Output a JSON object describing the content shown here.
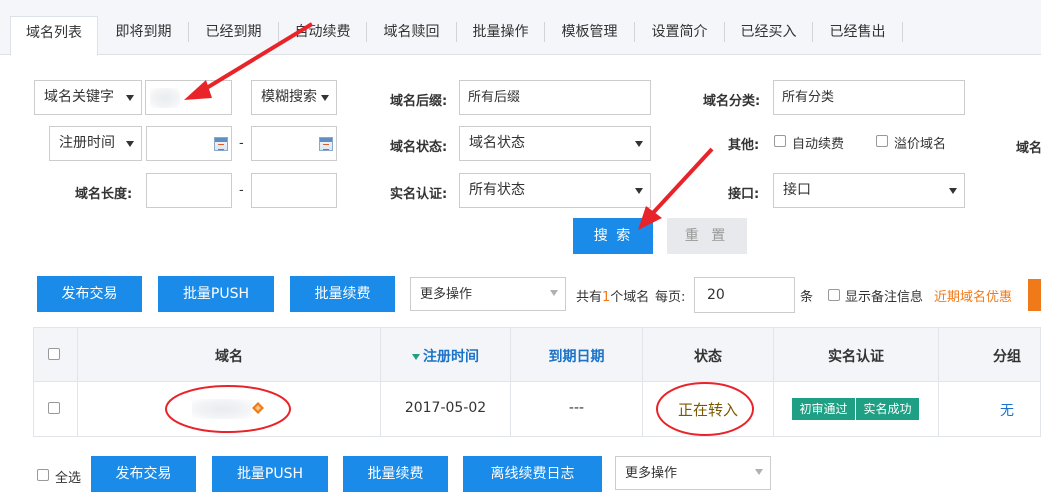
{
  "tabs": [
    {
      "label": "域名列表",
      "active": true
    },
    {
      "label": "即将到期"
    },
    {
      "label": "已经到期"
    },
    {
      "label": "自动续费"
    },
    {
      "label": "域名赎回"
    },
    {
      "label": "批量操作"
    },
    {
      "label": "模板管理"
    },
    {
      "label": "设置简介"
    },
    {
      "label": "已经买入"
    },
    {
      "label": "已经售出"
    }
  ],
  "filters": {
    "keyword_type": "域名关键字",
    "match_mode": "模糊搜索",
    "suffix_label": "域名后缀:",
    "suffix_placeholder": "所有后缀",
    "category_label": "域名分类:",
    "category_placeholder": "所有分类",
    "date_type": "注册时间",
    "date_sep": "-",
    "status_label": "域名状态:",
    "status_value": "域名状态",
    "other_label": "其他:",
    "auto_renew": "自动续费",
    "premium": "溢价域名",
    "cut_label": "域名",
    "length_label": "域名长度:",
    "length_sep": "-",
    "realname_label": "实名认证:",
    "realname_value": "所有状态",
    "api_label": "接口:",
    "api_value": "接口",
    "search_btn": "搜 索",
    "reset_btn": "重 置"
  },
  "toolbar": {
    "publish": "发布交易",
    "batch_push": "批量PUSH",
    "batch_renew": "批量续费",
    "more_ops": "更多操作",
    "count_prefix": "共有",
    "count": "1",
    "count_suffix": "个域名",
    "per_page_label": "每页:",
    "per_page_value": "20",
    "per_page_unit": "条",
    "show_notes": "显示备注信息",
    "promo": "近期域名优惠"
  },
  "table": {
    "headers": {
      "domain": "域名",
      "reg_date": "注册时间",
      "expire": "到期日期",
      "status": "状态",
      "realname": "实名认证",
      "group": "分组"
    },
    "rows": [
      {
        "reg_date": "2017-05-02",
        "expire": "---",
        "status": "正在转入",
        "badge1": "初审通过",
        "badge2": "实名成功",
        "group": "无"
      }
    ]
  },
  "footer": {
    "select_all": "全选",
    "publish": "发布交易",
    "batch_push": "批量PUSH",
    "batch_renew": "批量续费",
    "offline_log": "离线续费日志",
    "more_ops": "更多操作"
  },
  "colors": {
    "primary": "#1a8be8",
    "badge": "#1f9f83",
    "annotation": "#e8242a",
    "promo": "#f07a1a",
    "status_text": "#7a5a00"
  }
}
